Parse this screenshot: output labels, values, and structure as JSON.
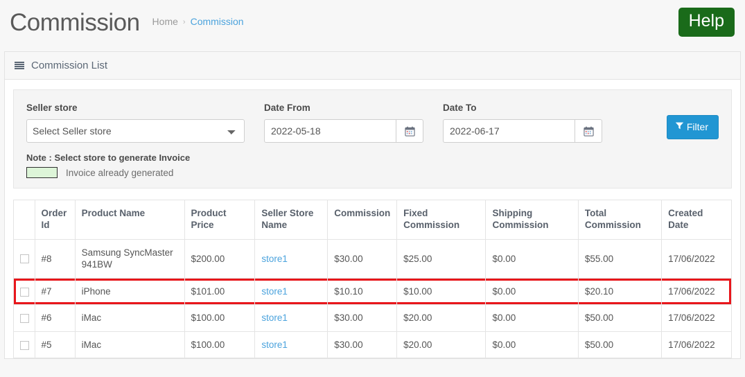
{
  "header": {
    "title": "Commission",
    "breadcrumb": {
      "home": "Home",
      "separator": "›",
      "current": "Commission"
    },
    "help_label": "Help",
    "help_color": "#1a6b1a"
  },
  "panel": {
    "heading": "Commission List",
    "heading_icon": "list-icon"
  },
  "filters": {
    "seller_store": {
      "label": "Seller store",
      "selected": "Select Seller store",
      "options": [
        "Select Seller store"
      ]
    },
    "date_from": {
      "label": "Date From",
      "value": "2022-05-18",
      "icon": "calendar-icon"
    },
    "date_to": {
      "label": "Date To",
      "value": "2022-06-17",
      "icon": "calendar-icon"
    },
    "filter_button": {
      "label": "Filter",
      "icon": "funnel-icon",
      "color": "#2196d3"
    },
    "note": "Note : Select store to generate Invoice",
    "legend": {
      "text": "Invoice already generated",
      "swatch_color": "#ddf5d8"
    }
  },
  "table": {
    "columns": [
      "",
      "Order Id",
      "Product Name",
      "Product Price",
      "Seller Store Name",
      "Commission",
      "Fixed Commission",
      "Shipping Commission",
      "Total Commission",
      "Created Date"
    ],
    "highlight_color": "#e8161b",
    "rows": [
      {
        "order_id": "#8",
        "product_name": "Samsung SyncMaster 941BW",
        "product_price": "$200.00",
        "seller_store_name": "store1",
        "commission": "$30.00",
        "fixed_commission": "$25.00",
        "shipping_commission": "$0.00",
        "total_commission": "$55.00",
        "created_date": "17/06/2022",
        "highlighted": false
      },
      {
        "order_id": "#7",
        "product_name": "iPhone",
        "product_price": "$101.00",
        "seller_store_name": "store1",
        "commission": "$10.10",
        "fixed_commission": "$10.00",
        "shipping_commission": "$0.00",
        "total_commission": "$20.10",
        "created_date": "17/06/2022",
        "highlighted": true
      },
      {
        "order_id": "#6",
        "product_name": "iMac",
        "product_price": "$100.00",
        "seller_store_name": "store1",
        "commission": "$30.00",
        "fixed_commission": "$20.00",
        "shipping_commission": "$0.00",
        "total_commission": "$50.00",
        "created_date": "17/06/2022",
        "highlighted": false
      },
      {
        "order_id": "#5",
        "product_name": "iMac",
        "product_price": "$100.00",
        "seller_store_name": "store1",
        "commission": "$30.00",
        "fixed_commission": "$20.00",
        "shipping_commission": "$0.00",
        "total_commission": "$50.00",
        "created_date": "17/06/2022",
        "highlighted": false
      }
    ]
  }
}
